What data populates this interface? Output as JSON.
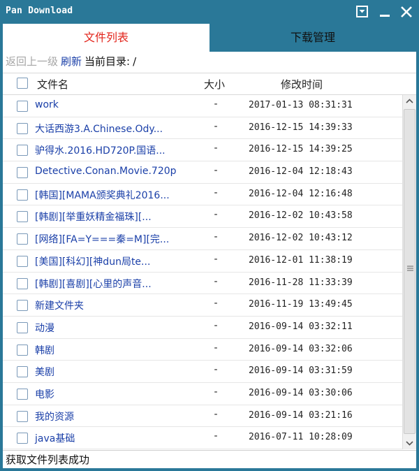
{
  "window": {
    "title": "Pan Download"
  },
  "tabs": [
    {
      "label": "文件列表",
      "active": true
    },
    {
      "label": "下载管理",
      "active": false
    }
  ],
  "pathbar": {
    "up": "返回上一级",
    "refresh": "刷新",
    "current_label": "当前目录:",
    "current_path": "/"
  },
  "columns": {
    "name": "文件名",
    "size": "大小",
    "time": "修改时间"
  },
  "rows": [
    {
      "name": "work",
      "size": "-",
      "time": "2017-01-13 08:31:31"
    },
    {
      "name": "大话西游3.A.Chinese.Ody...",
      "size": "-",
      "time": "2016-12-15 14:39:33"
    },
    {
      "name": "驴得水.2016.HD720P.国语...",
      "size": "-",
      "time": "2016-12-15 14:39:25"
    },
    {
      "name": "Detective.Conan.Movie.720p",
      "size": "-",
      "time": "2016-12-04 12:18:43"
    },
    {
      "name": "[韩国][MAMA颁奖典礼2016...",
      "size": "-",
      "time": "2016-12-04 12:16:48"
    },
    {
      "name": "[韩剧][举重妖精金福珠][...",
      "size": "-",
      "time": "2016-12-02 10:43:58"
    },
    {
      "name": "[网络][FA=Y===秦=M][完...",
      "size": "-",
      "time": "2016-12-02 10:43:12"
    },
    {
      "name": "[美国][科幻][神dun局te...",
      "size": "-",
      "time": "2016-12-01 11:38:19"
    },
    {
      "name": "[韩剧][喜剧][心里的声音...",
      "size": "-",
      "time": "2016-11-28 11:33:39"
    },
    {
      "name": "新建文件夹",
      "size": "-",
      "time": "2016-11-19 13:49:45"
    },
    {
      "name": "动漫",
      "size": "-",
      "time": "2016-09-14 03:32:11"
    },
    {
      "name": "韩剧",
      "size": "-",
      "time": "2016-09-14 03:32:06"
    },
    {
      "name": "美剧",
      "size": "-",
      "time": "2016-09-14 03:31:59"
    },
    {
      "name": "电影",
      "size": "-",
      "time": "2016-09-14 03:30:06"
    },
    {
      "name": "我的资源",
      "size": "-",
      "time": "2016-09-14 03:21:16"
    },
    {
      "name": "java基础",
      "size": "-",
      "time": "2016-07-11 10:28:09"
    }
  ],
  "status": {
    "text": "获取文件列表成功"
  },
  "colors": {
    "titlebar": "#2a7898",
    "active_tab_text": "#e2231a",
    "link": "#1a3fa8",
    "disabled": "#a6a6a6"
  }
}
